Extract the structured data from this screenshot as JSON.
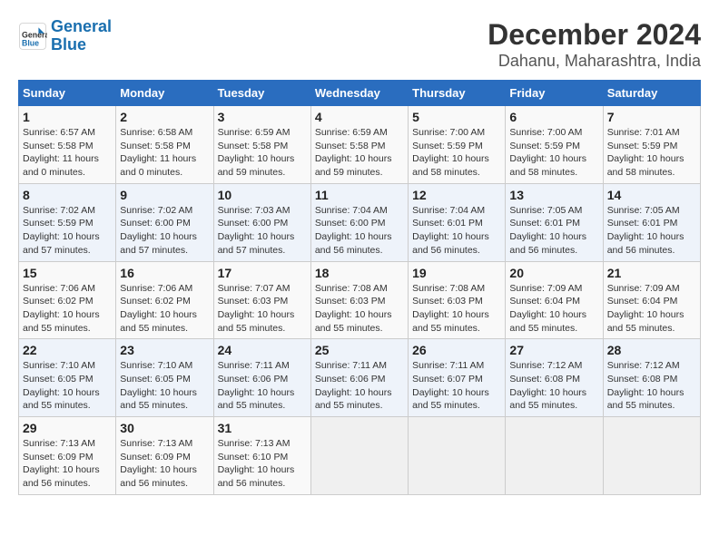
{
  "header": {
    "logo_line1": "General",
    "logo_line2": "Blue",
    "month": "December 2024",
    "location": "Dahanu, Maharashtra, India"
  },
  "weekdays": [
    "Sunday",
    "Monday",
    "Tuesday",
    "Wednesday",
    "Thursday",
    "Friday",
    "Saturday"
  ],
  "weeks": [
    [
      {
        "day": 1,
        "info": "Sunrise: 6:57 AM\nSunset: 5:58 PM\nDaylight: 11 hours\nand 0 minutes."
      },
      {
        "day": 2,
        "info": "Sunrise: 6:58 AM\nSunset: 5:58 PM\nDaylight: 11 hours\nand 0 minutes."
      },
      {
        "day": 3,
        "info": "Sunrise: 6:59 AM\nSunset: 5:58 PM\nDaylight: 10 hours\nand 59 minutes."
      },
      {
        "day": 4,
        "info": "Sunrise: 6:59 AM\nSunset: 5:58 PM\nDaylight: 10 hours\nand 59 minutes."
      },
      {
        "day": 5,
        "info": "Sunrise: 7:00 AM\nSunset: 5:59 PM\nDaylight: 10 hours\nand 58 minutes."
      },
      {
        "day": 6,
        "info": "Sunrise: 7:00 AM\nSunset: 5:59 PM\nDaylight: 10 hours\nand 58 minutes."
      },
      {
        "day": 7,
        "info": "Sunrise: 7:01 AM\nSunset: 5:59 PM\nDaylight: 10 hours\nand 58 minutes."
      }
    ],
    [
      {
        "day": 8,
        "info": "Sunrise: 7:02 AM\nSunset: 5:59 PM\nDaylight: 10 hours\nand 57 minutes."
      },
      {
        "day": 9,
        "info": "Sunrise: 7:02 AM\nSunset: 6:00 PM\nDaylight: 10 hours\nand 57 minutes."
      },
      {
        "day": 10,
        "info": "Sunrise: 7:03 AM\nSunset: 6:00 PM\nDaylight: 10 hours\nand 57 minutes."
      },
      {
        "day": 11,
        "info": "Sunrise: 7:04 AM\nSunset: 6:00 PM\nDaylight: 10 hours\nand 56 minutes."
      },
      {
        "day": 12,
        "info": "Sunrise: 7:04 AM\nSunset: 6:01 PM\nDaylight: 10 hours\nand 56 minutes."
      },
      {
        "day": 13,
        "info": "Sunrise: 7:05 AM\nSunset: 6:01 PM\nDaylight: 10 hours\nand 56 minutes."
      },
      {
        "day": 14,
        "info": "Sunrise: 7:05 AM\nSunset: 6:01 PM\nDaylight: 10 hours\nand 56 minutes."
      }
    ],
    [
      {
        "day": 15,
        "info": "Sunrise: 7:06 AM\nSunset: 6:02 PM\nDaylight: 10 hours\nand 55 minutes."
      },
      {
        "day": 16,
        "info": "Sunrise: 7:06 AM\nSunset: 6:02 PM\nDaylight: 10 hours\nand 55 minutes."
      },
      {
        "day": 17,
        "info": "Sunrise: 7:07 AM\nSunset: 6:03 PM\nDaylight: 10 hours\nand 55 minutes."
      },
      {
        "day": 18,
        "info": "Sunrise: 7:08 AM\nSunset: 6:03 PM\nDaylight: 10 hours\nand 55 minutes."
      },
      {
        "day": 19,
        "info": "Sunrise: 7:08 AM\nSunset: 6:03 PM\nDaylight: 10 hours\nand 55 minutes."
      },
      {
        "day": 20,
        "info": "Sunrise: 7:09 AM\nSunset: 6:04 PM\nDaylight: 10 hours\nand 55 minutes."
      },
      {
        "day": 21,
        "info": "Sunrise: 7:09 AM\nSunset: 6:04 PM\nDaylight: 10 hours\nand 55 minutes."
      }
    ],
    [
      {
        "day": 22,
        "info": "Sunrise: 7:10 AM\nSunset: 6:05 PM\nDaylight: 10 hours\nand 55 minutes."
      },
      {
        "day": 23,
        "info": "Sunrise: 7:10 AM\nSunset: 6:05 PM\nDaylight: 10 hours\nand 55 minutes."
      },
      {
        "day": 24,
        "info": "Sunrise: 7:11 AM\nSunset: 6:06 PM\nDaylight: 10 hours\nand 55 minutes."
      },
      {
        "day": 25,
        "info": "Sunrise: 7:11 AM\nSunset: 6:06 PM\nDaylight: 10 hours\nand 55 minutes."
      },
      {
        "day": 26,
        "info": "Sunrise: 7:11 AM\nSunset: 6:07 PM\nDaylight: 10 hours\nand 55 minutes."
      },
      {
        "day": 27,
        "info": "Sunrise: 7:12 AM\nSunset: 6:08 PM\nDaylight: 10 hours\nand 55 minutes."
      },
      {
        "day": 28,
        "info": "Sunrise: 7:12 AM\nSunset: 6:08 PM\nDaylight: 10 hours\nand 55 minutes."
      }
    ],
    [
      {
        "day": 29,
        "info": "Sunrise: 7:13 AM\nSunset: 6:09 PM\nDaylight: 10 hours\nand 56 minutes."
      },
      {
        "day": 30,
        "info": "Sunrise: 7:13 AM\nSunset: 6:09 PM\nDaylight: 10 hours\nand 56 minutes."
      },
      {
        "day": 31,
        "info": "Sunrise: 7:13 AM\nSunset: 6:10 PM\nDaylight: 10 hours\nand 56 minutes."
      },
      null,
      null,
      null,
      null
    ]
  ]
}
